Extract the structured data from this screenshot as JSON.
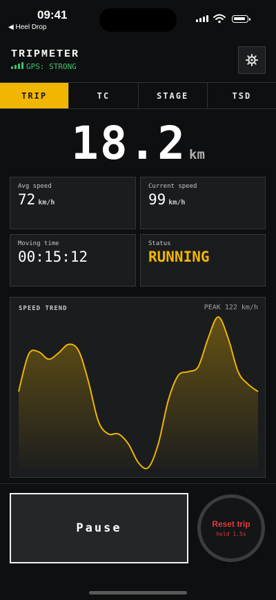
{
  "status_bar": {
    "time": "09:41",
    "back_app": "◀ Heel Drop"
  },
  "header": {
    "title": "TRIPMETER",
    "gps_status": "GPS: STRONG",
    "settings_icon": "gear-icon"
  },
  "tabs": [
    {
      "label": "TRIP",
      "active": true
    },
    {
      "label": "TC",
      "active": false
    },
    {
      "label": "STAGE",
      "active": false
    },
    {
      "label": "TSD",
      "active": false
    }
  ],
  "distance": {
    "value": "18.2",
    "unit": "km"
  },
  "stats": {
    "avg_speed": {
      "label": "Avg speed",
      "value": "72",
      "unit": "km/h"
    },
    "current_speed": {
      "label": "Current speed",
      "value": "99",
      "unit": "km/h"
    },
    "moving_time": {
      "label": "Moving time",
      "value": "00:15:12"
    },
    "status": {
      "label": "Status",
      "value": "RUNNING"
    }
  },
  "chart_title": "SPEED TREND",
  "chart_peak": "PEAK 122 km/h",
  "chart_data": {
    "type": "area",
    "title": "SPEED TREND",
    "ylim": [
      0,
      122
    ],
    "series": [
      {
        "values": [
          62,
          92,
          94,
          88,
          93,
          100,
          95,
          70,
          38,
          28,
          28,
          20,
          5,
          1,
          20,
          55,
          75,
          78,
          82,
          105,
          122,
          105,
          78,
          68,
          62
        ]
      }
    ],
    "annotations": [
      "PEAK 122 km/h"
    ]
  },
  "controls": {
    "pause_label": "Pause",
    "reset_label": "Reset trip",
    "reset_hint": "hold 1.5s"
  },
  "colors": {
    "accent": "#f0b600",
    "gps_green": "#3ec46d",
    "danger": "#e0393e",
    "background": "#0e0f10"
  }
}
